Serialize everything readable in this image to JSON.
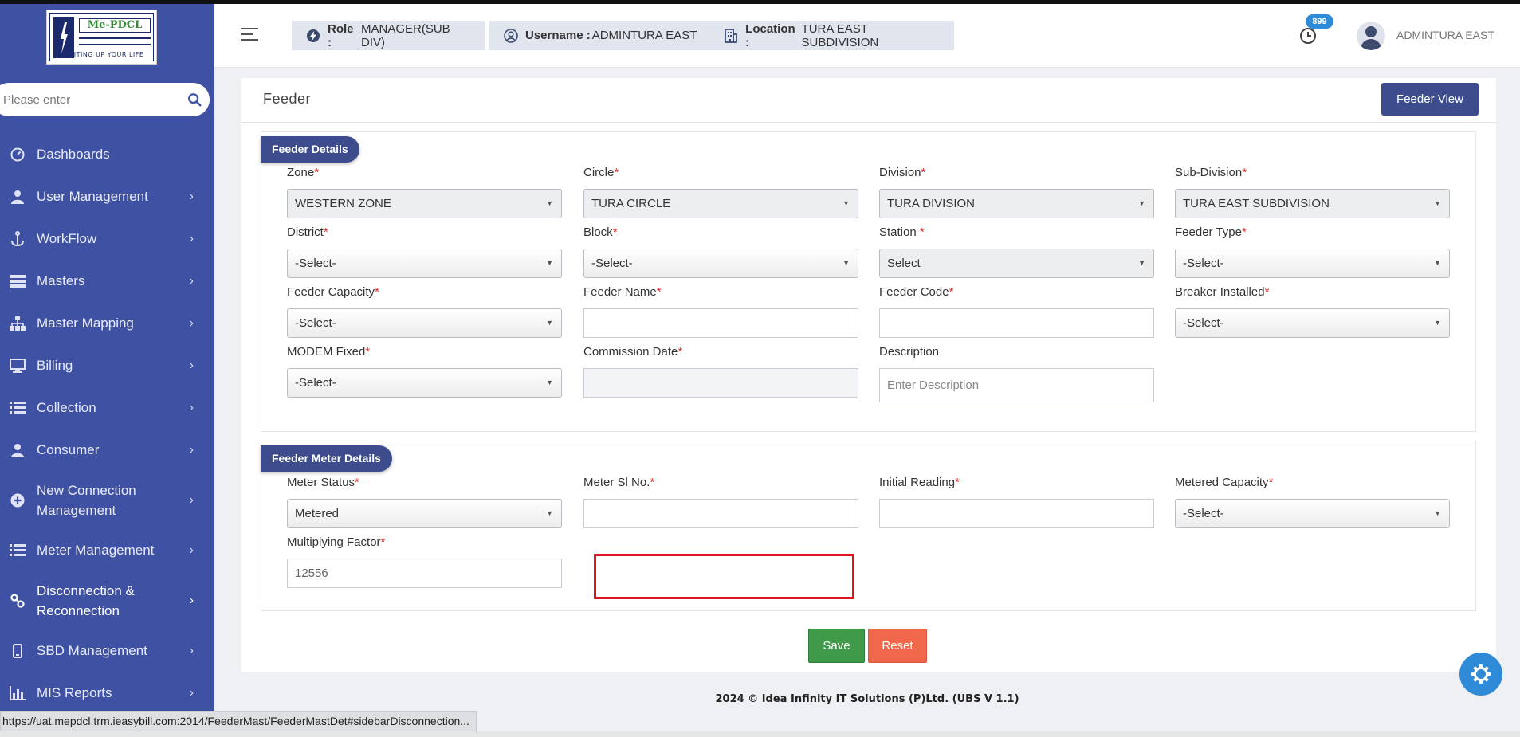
{
  "brand": {
    "logo_title": "Me-PDCL",
    "logo_tagline": "LIGHTING UP YOUR LIFE"
  },
  "search": {
    "placeholder": "Please enter"
  },
  "sidebar": {
    "items": [
      {
        "label": "Dashboards",
        "icon": "dashboard-icon",
        "chevron": false
      },
      {
        "label": "User Management",
        "icon": "user-icon",
        "chevron": true
      },
      {
        "label": "WorkFlow",
        "icon": "anchor-icon",
        "chevron": true
      },
      {
        "label": "Masters",
        "icon": "list-icon",
        "chevron": true
      },
      {
        "label": "Master Mapping",
        "icon": "sitemap-icon",
        "chevron": true
      },
      {
        "label": "Billing",
        "icon": "monitor-icon",
        "chevron": true
      },
      {
        "label": "Collection",
        "icon": "list-icon",
        "chevron": true
      },
      {
        "label": "Consumer",
        "icon": "user-icon",
        "chevron": true
      },
      {
        "label": "New Connection Management",
        "icon": "plus-circle-icon",
        "chevron": true
      },
      {
        "label": "Meter Management",
        "icon": "list-icon",
        "chevron": true
      },
      {
        "label": "Disconnection & Reconnection",
        "icon": "link-icon",
        "chevron": true,
        "active": true
      },
      {
        "label": "SBD Management",
        "icon": "mobile-icon",
        "chevron": true
      },
      {
        "label": "MIS Reports",
        "icon": "bar-chart-icon",
        "chevron": true
      }
    ]
  },
  "header": {
    "role_label": "Role :",
    "role_value": "MANAGER(SUB DIV)",
    "username_label": "Username :",
    "username_value": "ADMINTURA EAST",
    "location_label": "Location :",
    "location_value": "TURA EAST SUBDIVISION",
    "notification_count": "899",
    "user_name": "ADMINTURA EAST"
  },
  "page": {
    "title": "Feeder",
    "view_button": "Feeder View"
  },
  "feeder_details": {
    "title": "Feeder Details",
    "zone": {
      "label": "Zone",
      "value": "WESTERN ZONE"
    },
    "circle": {
      "label": "Circle",
      "value": "TURA CIRCLE"
    },
    "division": {
      "label": "Division",
      "value": "TURA DIVISION"
    },
    "sub_division": {
      "label": "Sub-Division",
      "value": "TURA EAST SUBDIVISION"
    },
    "district": {
      "label": "District",
      "value": "-Select-"
    },
    "block": {
      "label": "Block",
      "value": "-Select-"
    },
    "station": {
      "label": "Station ",
      "value": "Select"
    },
    "feeder_type": {
      "label": "Feeder Type",
      "value": "-Select-"
    },
    "feeder_capacity": {
      "label": "Feeder Capacity",
      "value": "-Select-"
    },
    "feeder_name": {
      "label": "Feeder Name",
      "value": ""
    },
    "feeder_code": {
      "label": "Feeder Code",
      "value": ""
    },
    "breaker_installed": {
      "label": "Breaker Installed",
      "value": "-Select-"
    },
    "modem_fixed": {
      "label": "MODEM Fixed",
      "value": "-Select-"
    },
    "commission_date": {
      "label": "Commission Date",
      "value": ""
    },
    "description": {
      "label": "Description",
      "placeholder": "Enter Description"
    }
  },
  "meter_details": {
    "title": "Feeder Meter Details",
    "meter_status": {
      "label": "Meter Status",
      "value": "Metered"
    },
    "meter_sl_no": {
      "label": "Meter Sl No.",
      "value": ""
    },
    "initial_reading": {
      "label": "Initial Reading",
      "value": ""
    },
    "metered_capacity": {
      "label": "Metered Capacity",
      "value": "-Select-"
    },
    "multiplying_factor": {
      "label": "Multiplying Factor",
      "value": "12556"
    }
  },
  "actions": {
    "save": "Save",
    "reset": "Reset"
  },
  "footer": {
    "text": "2024 © Idea Infinity IT Solutions (P)Ltd. (UBS V 1.1)"
  },
  "status_url": "https://uat.mepdcl.trm.ieasybill.com:2014/FeederMast/FeederMastDet#sidebarDisconnection...",
  "colors": {
    "sidebar": "#3f51a3",
    "accent": "#3d4c8c",
    "save": "#3f9a4a",
    "reset": "#f0674b",
    "highlight": "#e0141e",
    "badge": "#2f8ad8"
  }
}
